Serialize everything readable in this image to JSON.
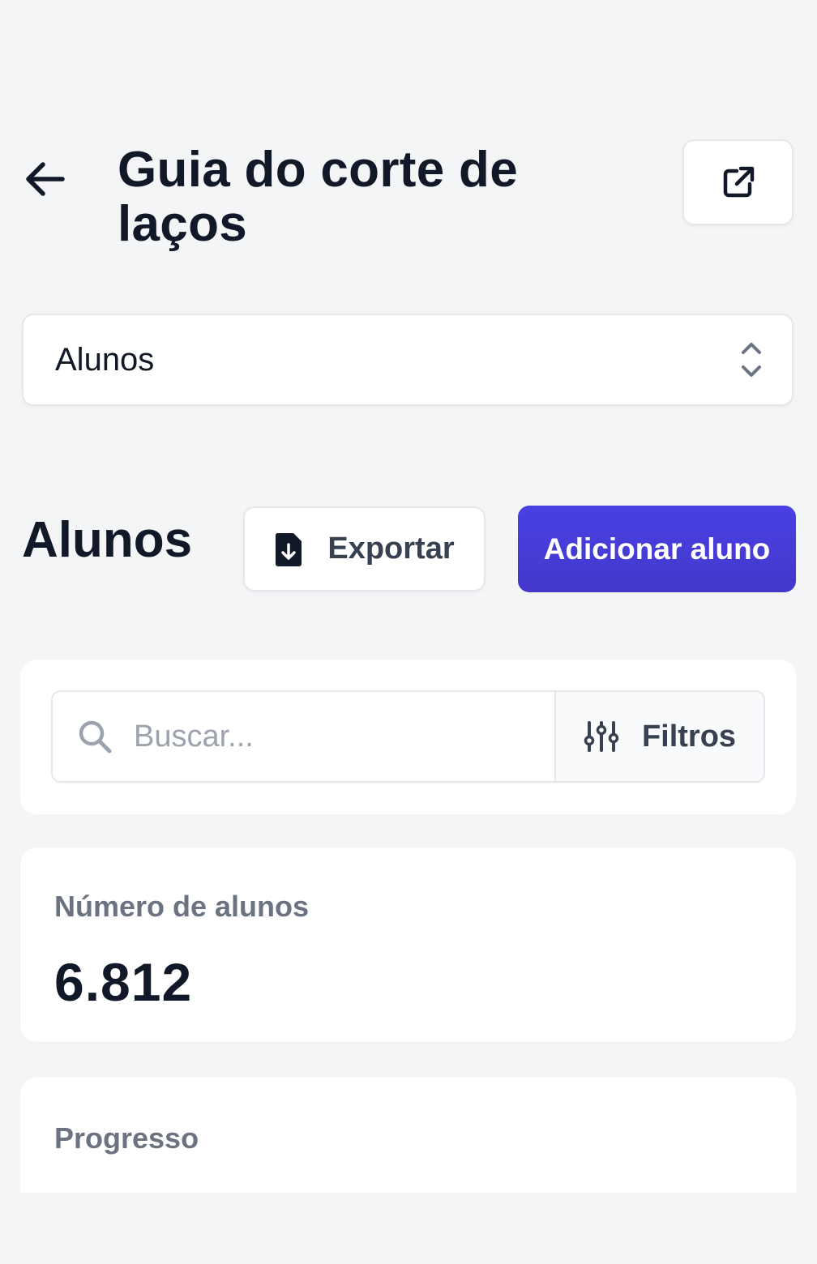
{
  "header": {
    "title": "Guia do corte de laços",
    "back_icon": "arrow-left-icon",
    "external_icon": "external-link-icon"
  },
  "course_select": {
    "value": "Alunos",
    "icon": "chevron-up-down-icon"
  },
  "section": {
    "title": "Alunos",
    "export_label": "Exportar",
    "export_icon": "file-download-icon",
    "add_label": "Adicionar aluno"
  },
  "search": {
    "placeholder": "Buscar...",
    "value": "",
    "icon": "search-icon",
    "filters_label": "Filtros",
    "filters_icon": "sliders-icon"
  },
  "stats": {
    "students_label": "Número de alunos",
    "students_value": "6.812"
  },
  "progress": {
    "label": "Progresso"
  },
  "colors": {
    "background": "#f4f5f7",
    "primary": "#4338ca",
    "text": "#111827",
    "muted": "#6b7280"
  }
}
